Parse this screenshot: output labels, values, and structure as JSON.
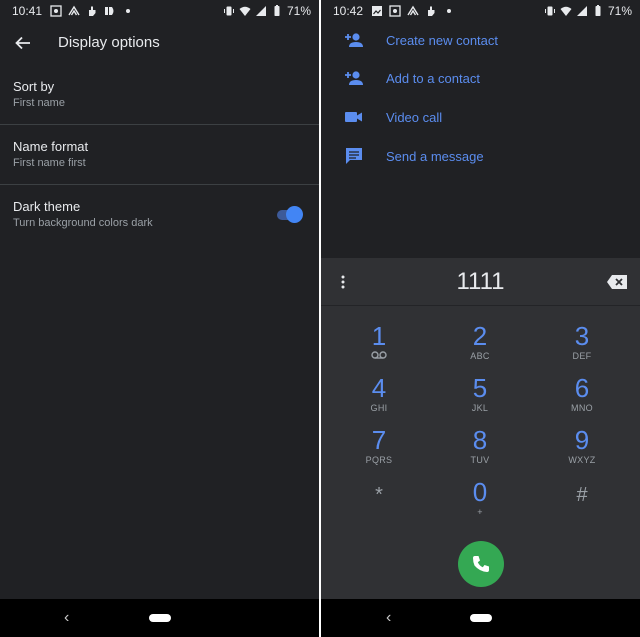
{
  "left": {
    "status": {
      "time": "10:41",
      "battery": "71%"
    },
    "toolbar": {
      "title": "Display options"
    },
    "settings": [
      {
        "title": "Sort by",
        "subtitle": "First name"
      },
      {
        "title": "Name format",
        "subtitle": "First name first"
      },
      {
        "title": "Dark theme",
        "subtitle": "Turn background colors dark",
        "toggle_on": true
      }
    ]
  },
  "right": {
    "status": {
      "time": "10:42",
      "battery": "71%"
    },
    "actions": [
      {
        "label": "Create new contact",
        "icon": "person-add-icon"
      },
      {
        "label": "Add to a contact",
        "icon": "person-add-icon"
      },
      {
        "label": "Video call",
        "icon": "videocam-icon"
      },
      {
        "label": "Send a message",
        "icon": "message-icon"
      }
    ],
    "dialpad": {
      "digits": "1111",
      "keys": [
        {
          "digit": "1",
          "letters": ""
        },
        {
          "digit": "2",
          "letters": "ABC"
        },
        {
          "digit": "3",
          "letters": "DEF"
        },
        {
          "digit": "4",
          "letters": "GHI"
        },
        {
          "digit": "5",
          "letters": "JKL"
        },
        {
          "digit": "6",
          "letters": "MNO"
        },
        {
          "digit": "7",
          "letters": "PQRS"
        },
        {
          "digit": "8",
          "letters": "TUV"
        },
        {
          "digit": "9",
          "letters": "WXYZ"
        },
        {
          "digit": "*",
          "letters": ""
        },
        {
          "digit": "0",
          "letters": "+"
        },
        {
          "digit": "#",
          "letters": ""
        }
      ]
    }
  },
  "colors": {
    "background": "#202124",
    "dialpad_background": "#303134",
    "accent": "#5b8def",
    "call_green": "#34a853",
    "primary_text": "#e8eaed",
    "secondary_text": "#9aa0a6"
  }
}
